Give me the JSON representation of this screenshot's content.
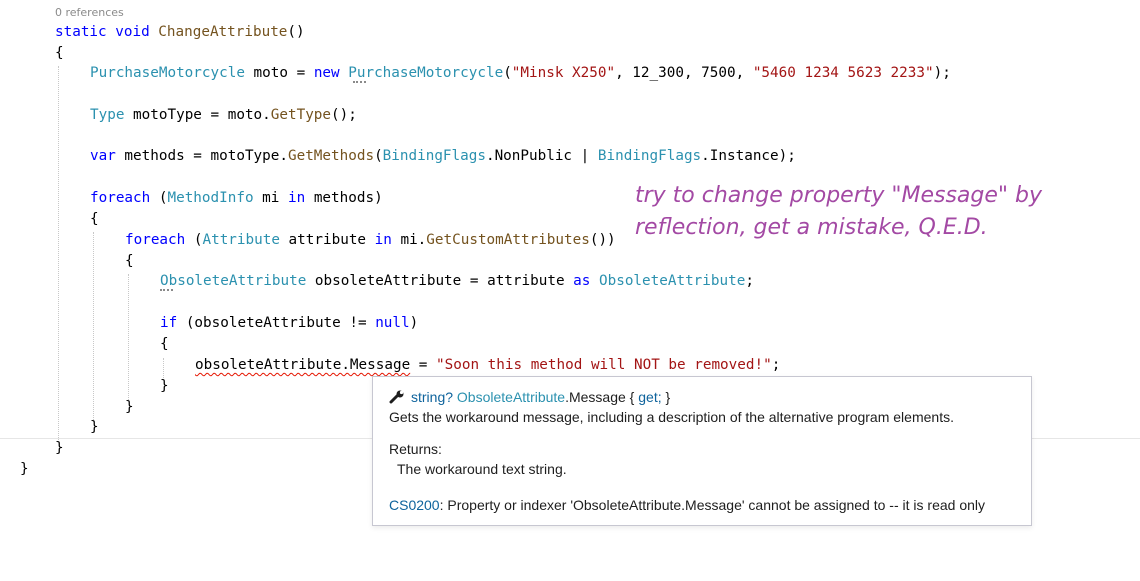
{
  "codelens": "0 references",
  "code": {
    "l1": {
      "kw": "static void",
      "name": "ChangeAttribute",
      "rest": "()"
    },
    "l2": "{",
    "l3": {
      "type": "PurchaseMotorcycle",
      "var": " moto = ",
      "kw": "new",
      "type2": "PurchaseMotorcycle",
      "open": "(",
      "str1": "\"Minsk X250\"",
      "args": ", 12_300, 7500, ",
      "str2": "\"5460 1234 5623 2233\"",
      "close": ");"
    },
    "l4": {
      "type": "Type",
      "rest1": " motoType = moto.",
      "method": "GetType",
      "rest2": "();"
    },
    "l5": {
      "kw": "var",
      "rest1": " methods = motoType.",
      "method": "GetMethods",
      "open": "(",
      "type1": "BindingFlags",
      "m1": ".NonPublic | ",
      "type2": "BindingFlags",
      "m2": ".Instance);"
    },
    "l6": {
      "kw": "foreach",
      "open": " (",
      "type": "MethodInfo",
      "mid": " mi ",
      "kw2": "in",
      "rest": " methods)"
    },
    "l7": "{",
    "l8": {
      "kw": "foreach",
      "open": " (",
      "type": "Attribute",
      "mid": " attribute ",
      "kw2": "in",
      "rest1": " mi.",
      "method": "GetCustomAttributes",
      "rest2": "())"
    },
    "l9": "{",
    "l10": {
      "type": "ObsoleteAttribute",
      "mid": " obsoleteAttribute = attribute ",
      "kw": "as",
      "sp": " ",
      "type2": "ObsoleteAttribute",
      "end": ";"
    },
    "l11": {
      "kw": "if",
      "mid": " (obsoleteAttribute != ",
      "kw2": "null",
      "end": ")"
    },
    "l12": "{",
    "l13": {
      "target": "obsoleteAttribute.Message",
      "eq": " = ",
      "str": "\"Soon this method will NOT be removed!\"",
      "end": ";"
    },
    "l14": "}",
    "l15": "}",
    "l16": "}",
    "l17": "}",
    "l18": "}"
  },
  "annotation": {
    "line1": "try to change property \"Message\" by",
    "line2": "reflection, get a mistake, Q.E.D."
  },
  "tooltip": {
    "icon": "wrench-icon",
    "sig_type": "string?",
    "sig_class": "ObsoleteAttribute",
    "sig_member": ".Message { ",
    "sig_get": "get;",
    "sig_end": " }",
    "description": "Gets the workaround message, including a description of the alternative program elements.",
    "returns_label": "Returns:",
    "returns_value": "The workaround text string.",
    "error_code": "CS0200",
    "error_text": ": Property or indexer 'ObsoleteAttribute.Message' cannot be assigned to -- it is read only"
  },
  "colors": {
    "keyword": "#0000ff",
    "type": "#2b91af",
    "string": "#a31515",
    "method": "#74531f",
    "annotation": "#a349a4",
    "error_squiggle": "#e51400"
  }
}
